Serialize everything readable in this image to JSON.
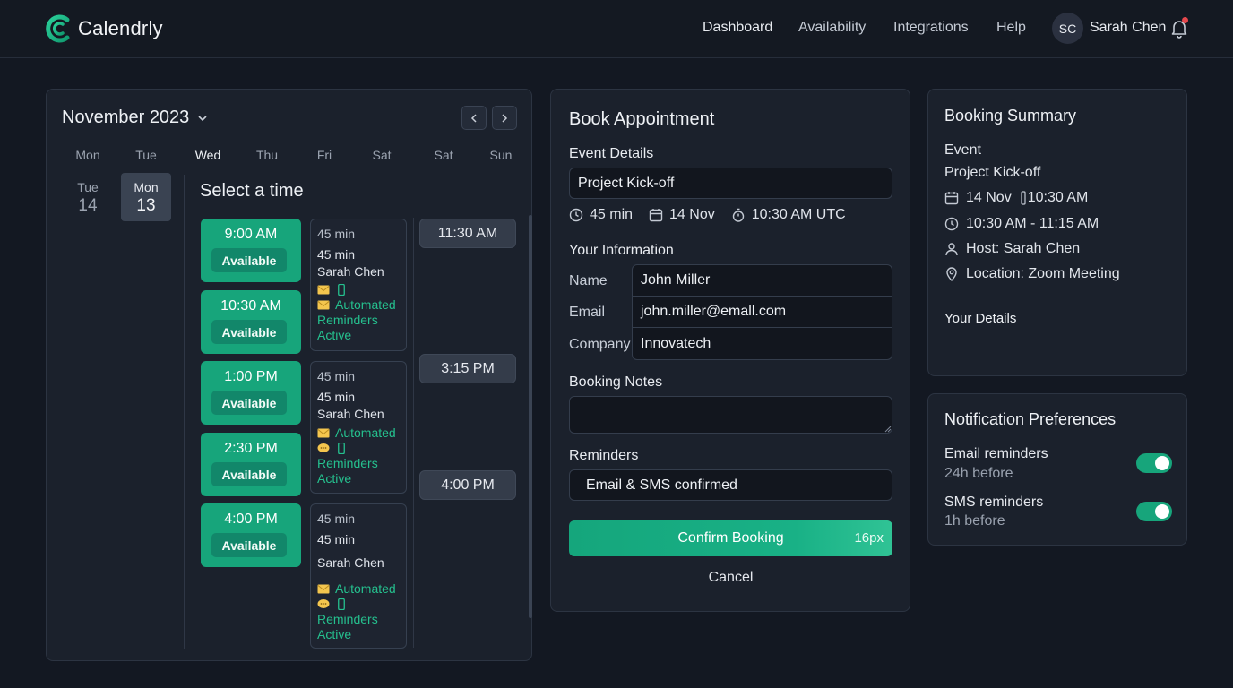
{
  "app": {
    "brand": "Calendrly"
  },
  "nav": {
    "links": [
      "Dashboard",
      "Availability",
      "Integrations",
      "Help"
    ],
    "user_initials": "SC",
    "user_name": "Sarah Chen"
  },
  "calendar": {
    "month": "November 2023",
    "weekdays": [
      "Mon",
      "Tue",
      "Wed",
      "Thu",
      "Fri",
      "Sat",
      "Sat",
      "Sun"
    ],
    "dates": [
      {
        "day": "Tue",
        "num": "14"
      },
      {
        "day": "Mon",
        "num": "13"
      }
    ],
    "select_time_title": "Select a time",
    "slots": [
      {
        "time": "9:00 AM",
        "status": "Available"
      },
      {
        "time": "10:30 AM",
        "status": "Available"
      },
      {
        "time": "1:00 PM",
        "status": "Available"
      },
      {
        "time": "2:30 PM",
        "status": "Available"
      },
      {
        "time": "4:00 PM",
        "status": "Available"
      }
    ],
    "details": [
      {
        "duration_a": "45 min",
        "duration_b": "45 min",
        "host": "Sarah Chen",
        "line1": "Automated",
        "line2": "Reminders",
        "line3": "Active"
      },
      {
        "duration_a": "45 min",
        "duration_b": "45 min",
        "host": "Sarah Chen",
        "line1": "Automated",
        "line2": "Reminders",
        "line3": "Active"
      },
      {
        "duration_a": "45 min",
        "duration_b": "45 min",
        "host": "Sarah Chen",
        "line1": "Automated",
        "line2": "Reminders",
        "line3": "Active"
      }
    ],
    "alt_slots": [
      "11:30 AM",
      "3:15 PM",
      "4:00 PM"
    ]
  },
  "booking": {
    "title": "Book Appointment",
    "event_details_label": "Event Details",
    "event_name": "Project Kick-off",
    "meta": {
      "duration": "45 min",
      "date": "14 Nov",
      "time": "10:30 AM UTC"
    },
    "your_info_label": "Your Information",
    "fields": [
      {
        "label": "Name",
        "value": "John Miller"
      },
      {
        "label": "Email",
        "value": "john.miller@emall.com"
      },
      {
        "label": "Company",
        "value": "Innovatech"
      }
    ],
    "notes_label": "Booking Notes",
    "notes_value": "",
    "reminders_label": "Reminders",
    "reminders_value": "Email & SMS confirmed",
    "confirm_label": "Confirm Booking",
    "confirm_tag": "16px",
    "cancel_label": "Cancel"
  },
  "summary": {
    "title": "Booking Summary",
    "event_label": "Event",
    "event_name": "Project Kick-off",
    "date": "14 Nov",
    "time": "10:30 AM",
    "range": "10:30 AM - 11:15 AM",
    "host": "Host: Sarah Chen",
    "location": "Location: Zoom Meeting",
    "your_details": "Your Details"
  },
  "notifications": {
    "title": "Notification Preferences",
    "items": [
      {
        "label": "Email reminders",
        "sub": "24h before",
        "enabled": true
      },
      {
        "label": "SMS reminders",
        "sub": "1h before",
        "enabled": true
      }
    ]
  },
  "colors": {
    "accent": "#17a57b",
    "background": "#131822",
    "panel": "#1b212c"
  }
}
